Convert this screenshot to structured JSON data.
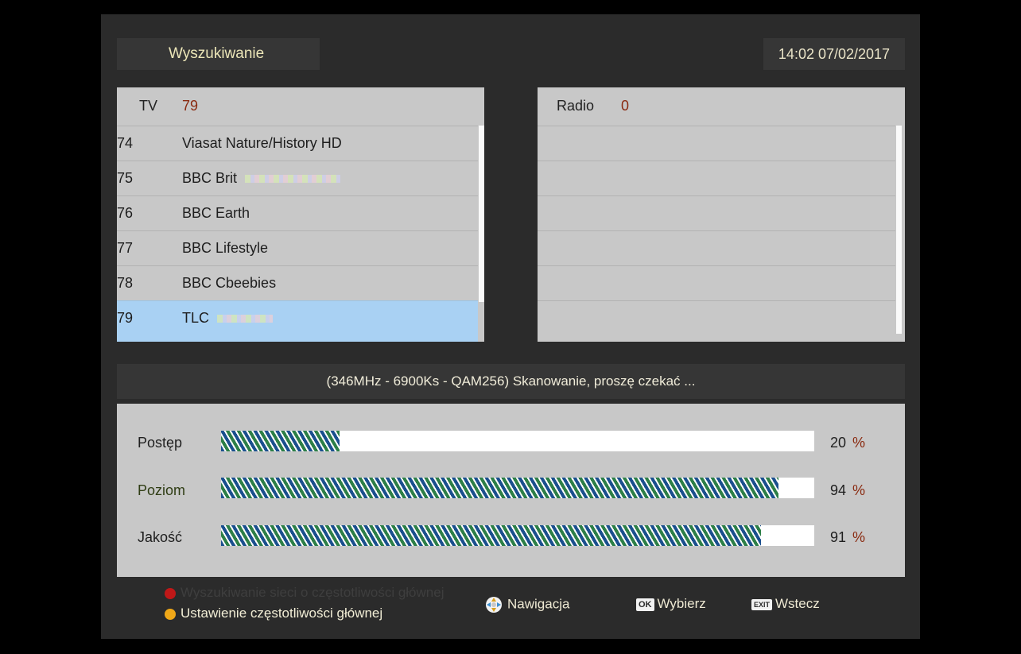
{
  "header": {
    "title": "Wyszukiwanie",
    "datetime": "14:02 07/02/2017"
  },
  "tv": {
    "label": "TV",
    "count": "79",
    "channels": [
      {
        "num": "74",
        "name": "Viasat Nature/History HD"
      },
      {
        "num": "75",
        "name": "BBC Brit"
      },
      {
        "num": "76",
        "name": "BBC Earth"
      },
      {
        "num": "77",
        "name": "BBC Lifestyle"
      },
      {
        "num": "78",
        "name": "BBC Cbeebies"
      },
      {
        "num": "79",
        "name": "TLC"
      }
    ]
  },
  "radio": {
    "label": "Radio",
    "count": "0"
  },
  "status": "(346MHz - 6900Ks - QAM256) Skanowanie, proszę czekać ...",
  "meters": [
    {
      "label": "Postęp",
      "value": "20",
      "unit": "%",
      "fraction": 0.2
    },
    {
      "label": "Poziom",
      "value": "94",
      "unit": "%",
      "fraction": 0.94
    },
    {
      "label": "Jakość",
      "value": "91",
      "unit": "%",
      "fraction": 0.91
    }
  ],
  "footer": {
    "red_hint": "Wyszukiwanie sieci o częstotliwości głównej",
    "orange_hint": "Ustawienie częstotliwości głównej",
    "nav_label": "Nawigacja",
    "ok_key": "OK",
    "ok_label": "Wybierz",
    "exit_key": "EXIT",
    "exit_label": "Wstecz"
  },
  "colors": {
    "red_key": "#c01818",
    "orange_key": "#f0a818",
    "selection": "#a9d1f3"
  }
}
